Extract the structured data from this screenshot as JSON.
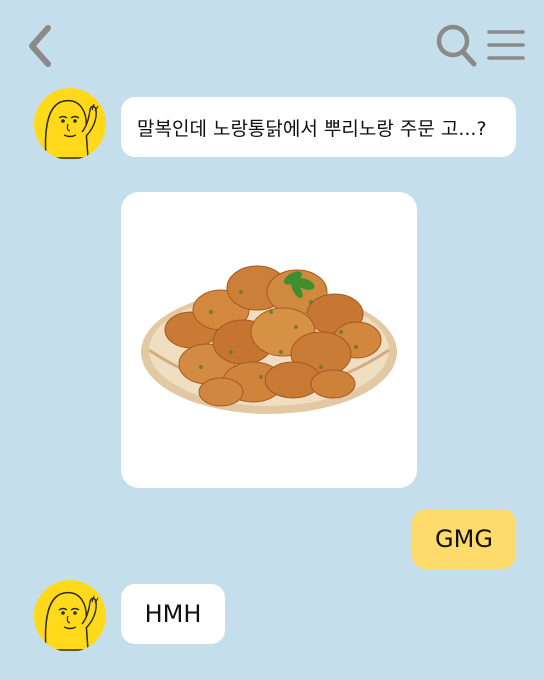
{
  "header": {
    "back_icon": "chevron-left-icon",
    "search_icon": "search-icon",
    "menu_icon": "hamburger-menu-icon",
    "icon_color": "#8a8a8a"
  },
  "messages": [
    {
      "sender": "other",
      "type": "text",
      "text": "말복인데 노랑통닭에서 뿌리노랑 주문 고...?"
    },
    {
      "sender": "other",
      "type": "image",
      "image": "fried-chicken-plate"
    },
    {
      "sender": "me",
      "type": "text",
      "text": "GMG"
    },
    {
      "sender": "other",
      "type": "text",
      "text": "HMH"
    }
  ],
  "colors": {
    "background": "#c4dfeb",
    "bubble_other": "#ffffff",
    "bubble_me": "#fedb6b",
    "avatar": "#ffd91a"
  }
}
